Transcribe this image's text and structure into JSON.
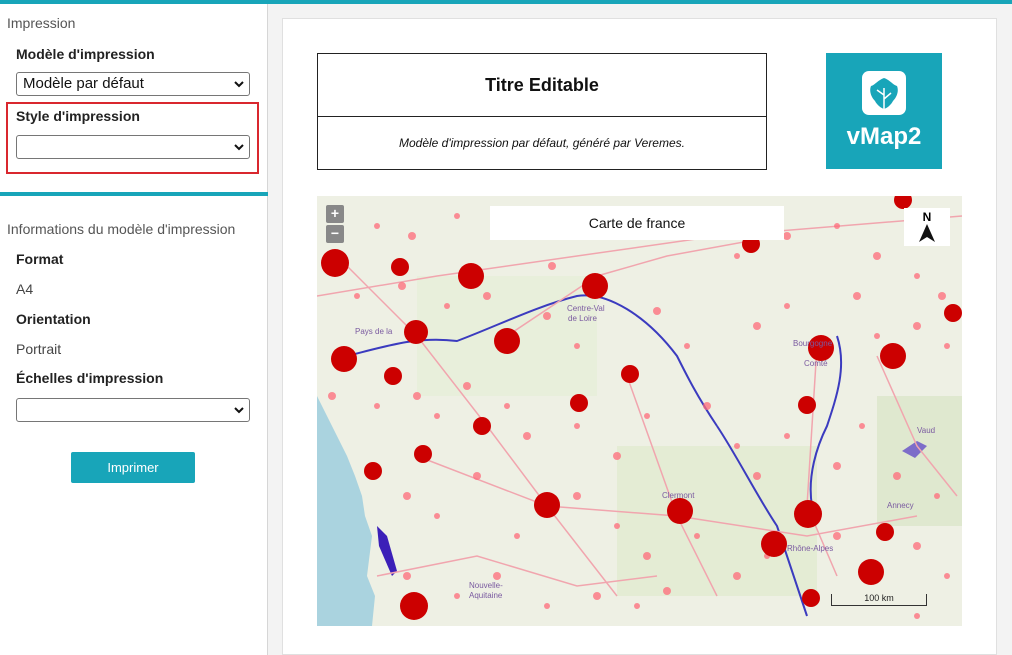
{
  "sidebar": {
    "section_impression": "Impression",
    "modele_label": "Modèle d'impression",
    "modele_value": "Modèle par défaut",
    "style_label": "Style d'impression",
    "style_value": "",
    "info_title": "Informations du modèle d'impression",
    "format_label": "Format",
    "format_value": "A4",
    "orientation_label": "Orientation",
    "orientation_value": "Portrait",
    "echelles_label": "Échelles d'impression",
    "echelles_value": "",
    "print_button": "Imprimer"
  },
  "preview": {
    "title": "Titre Editable",
    "subtitle": "Modèle d'impression par défaut, généré par Veremes.",
    "logo_text": "vMap2",
    "map_title": "Carte de france",
    "north_label": "N",
    "scale_label": "100 km",
    "zoom_in": "+",
    "zoom_out": "−"
  },
  "map_labels": [
    "Pays de la",
    "Centre-Val",
    "de Loire",
    "Bourgogne",
    "Comté",
    "Clermont",
    "Rhône-Alpes",
    "Nouvelle-",
    "Aquitaine",
    "Vaud",
    "Annecy"
  ],
  "colors": {
    "accent": "#18a5b9",
    "highlight": "#d9272e",
    "point_dark": "#cc0000",
    "point_light": "#ff6b7a"
  }
}
